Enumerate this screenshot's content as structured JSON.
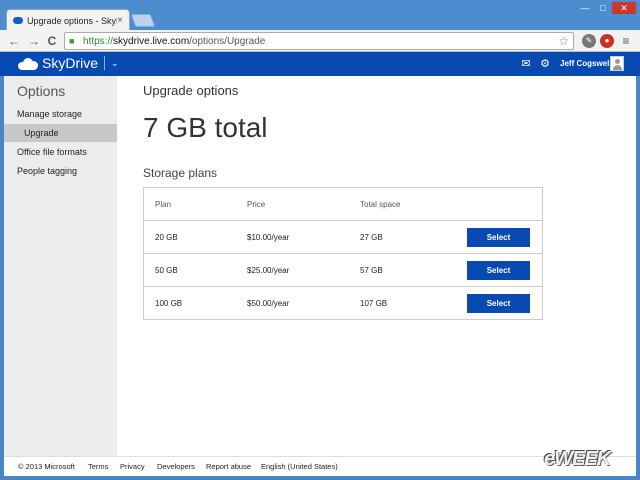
{
  "browser": {
    "tab_title": "Upgrade options - SkyDrive",
    "tab_close": "×",
    "window_controls": [
      "—",
      "□",
      "✕"
    ],
    "back_icon": "←",
    "forward_icon": "→",
    "reload_icon": "C",
    "url_scheme": "https://",
    "url_host": "skydrive.live.com",
    "url_path": "/options/Upgrade",
    "star_icon": "☆",
    "menu_icon": "≡"
  },
  "header": {
    "brand": "SkyDrive",
    "chevron": "⌄",
    "user_name": "Jeff Cogswell"
  },
  "sidebar": {
    "title": "Options",
    "items": [
      {
        "label": "Manage storage"
      },
      {
        "label": "Upgrade"
      },
      {
        "label": "Office file formats"
      },
      {
        "label": "People tagging"
      }
    ]
  },
  "main": {
    "title": "Upgrade options",
    "total": "7 GB total",
    "plans_heading": "Storage plans"
  },
  "plans": {
    "headers": {
      "plan": "Plan",
      "price": "Price",
      "space": "Total space"
    },
    "rows": [
      {
        "plan": "20 GB",
        "price": "$10.00/year",
        "space": "27 GB",
        "action": "Select"
      },
      {
        "plan": "50 GB",
        "price": "$25.00/year",
        "space": "57 GB",
        "action": "Select"
      },
      {
        "plan": "100 GB",
        "price": "$50.00/year",
        "space": "107 GB",
        "action": "Select"
      }
    ]
  },
  "footer": {
    "items": [
      "© 2013 Microsoft",
      "Terms",
      "Privacy",
      "Developers",
      "Report abuse",
      "English (United States)"
    ]
  },
  "watermark": "eWEEK",
  "colors": {
    "brand_blue": "#094ab2",
    "chrome_blue": "#4d8ccf",
    "sidebar_bg": "#ececec"
  }
}
